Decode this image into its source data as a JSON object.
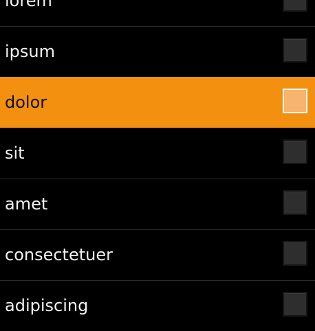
{
  "list": {
    "items": [
      {
        "label": "lorem",
        "checked": false,
        "selected": false
      },
      {
        "label": "ipsum",
        "checked": false,
        "selected": false
      },
      {
        "label": "dolor",
        "checked": false,
        "selected": true
      },
      {
        "label": "sit",
        "checked": false,
        "selected": false
      },
      {
        "label": "amet",
        "checked": false,
        "selected": false
      },
      {
        "label": "consectetuer",
        "checked": false,
        "selected": false
      },
      {
        "label": "adipiscing",
        "checked": false,
        "selected": false
      }
    ]
  },
  "colors": {
    "background": "#000000",
    "highlight": "#f3900f",
    "text": "#f2f2f2"
  }
}
